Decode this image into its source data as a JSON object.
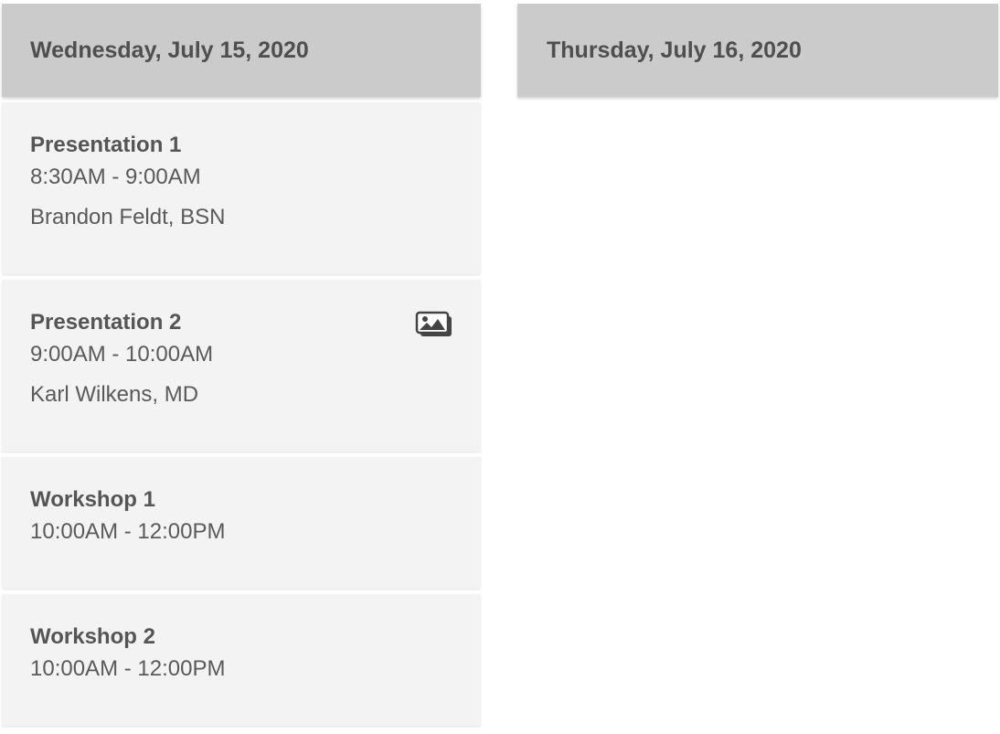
{
  "days": [
    {
      "date": "Wednesday, July 15, 2020",
      "sessions": [
        {
          "title": "Presentation 1",
          "time": "8:30AM - 9:00AM",
          "presenter": "Brandon Feldt, BSN"
        },
        {
          "title": "Presentation 2",
          "time": "9:00AM - 10:00AM",
          "presenter": "Karl Wilkens, MD",
          "icon": "images-icon"
        },
        {
          "title": "Workshop 1",
          "time": "10:00AM - 12:00PM"
        },
        {
          "title": "Workshop 2",
          "time": "10:00AM - 12:00PM"
        }
      ]
    },
    {
      "date": "Thursday, July 16, 2020",
      "sessions": []
    }
  ],
  "colors": {
    "header_bg": "#cbcbcb",
    "session_bg": "#f3f3f3",
    "text": "#555555"
  }
}
